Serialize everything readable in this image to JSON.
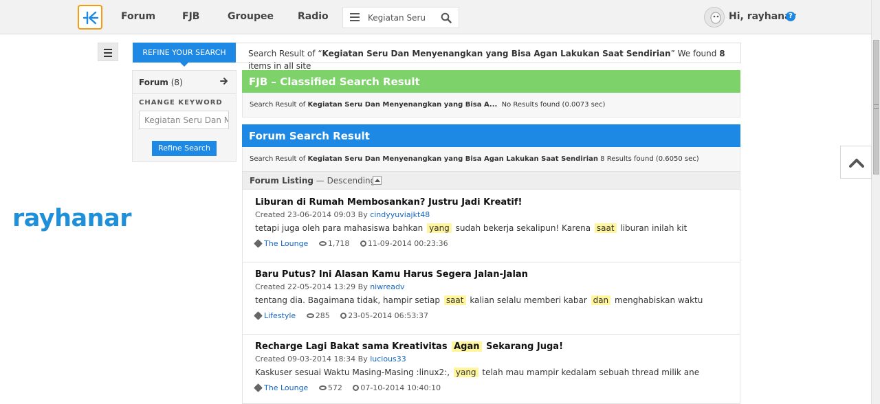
{
  "nav": {
    "links": [
      "Forum",
      "FJB",
      "Groupee",
      "Radio"
    ],
    "search_value": "Kegiatan Seru Dan Menyenangkan",
    "greeting": "Hi, rayhanar",
    "help": "?"
  },
  "watermark": "rayhanar",
  "refine": {
    "tab_label": "REFINE YOUR SEARCH",
    "forum_label": "Forum",
    "forum_count": "(8)",
    "change_keyword_label": "CHANGE KEYWORD",
    "keyword_value": "Kegiatan Seru Dan Menyenangkan",
    "button_label": "Refine Search"
  },
  "summary": {
    "prefix": "Search Result of “",
    "query": "Kegiatan Seru Dan Menyenangkan yang Bisa Agan Lakukan Saat Sendirian",
    "middle": "” We found ",
    "count": "8",
    "suffix": " items in all site"
  },
  "fjb": {
    "title": "FJB – Classified Search Result",
    "prefix": "Search Result of ",
    "query": "Kegiatan Seru Dan Menyenangkan yang Bisa A...",
    "result": "  No Results found (0.0073 sec)"
  },
  "forum_section": {
    "title": "Forum Search Result",
    "prefix": "Search Result of ",
    "query": "Kegiatan Seru Dan Menyenangkan yang Bisa Agan Lakukan Saat Sendirian",
    "result": " 8 Results found (0.6050 sec)"
  },
  "listing": {
    "label": "Forum Listing",
    "order": " — Descending"
  },
  "results": [
    {
      "title": [
        "Liburan di Rumah Membosankan? Justru Jadi Kreatif!"
      ],
      "created": "Created 23-06-2014 09:03 By ",
      "author": "cindyyuviajkt48",
      "snippet": [
        "tetapi juga oleh para mahasiswa bahkan ",
        "yang",
        " sudah bekerja sekalipun! Karena ",
        "saat",
        " liburan inilah kit"
      ],
      "category": "The Lounge",
      "views": "1,718",
      "last": "11-09-2014 00:23:36"
    },
    {
      "title": [
        "Baru Putus? Ini Alasan Kamu Harus Segera Jalan-Jalan"
      ],
      "created": "Created 22-05-2014 13:29 By ",
      "author": "niwreadv",
      "snippet": [
        "tentang dia. Bagaimana tidak, hampir setiap ",
        "saat",
        " kalian selalu memberi kabar ",
        "dan",
        " menghabiskan waktu"
      ],
      "category": "Lifestyle",
      "views": "285",
      "last": "23-05-2014 06:53:37"
    },
    {
      "title": [
        "Recharge Lagi Bakat sama Kreativitas ",
        "Agan",
        " Sekarang Juga!"
      ],
      "created": "Created 09-03-2014 18:34 By ",
      "author": "lucious33",
      "snippet": [
        "Kaskuser sesuai Waktu Masing-Masing :linux2:, ",
        "yang",
        " telah mau mampir kedalam sebuah thread milik ane"
      ],
      "category": "The Lounge",
      "views": "572",
      "last": "07-10-2014 10:40:10"
    }
  ],
  "colors": {
    "fjb_header": "#7dd36a",
    "forum_header": "#1e88e5",
    "highlight": "#fff59d",
    "link": "#1565c0",
    "logo_border": "#f39c12"
  }
}
